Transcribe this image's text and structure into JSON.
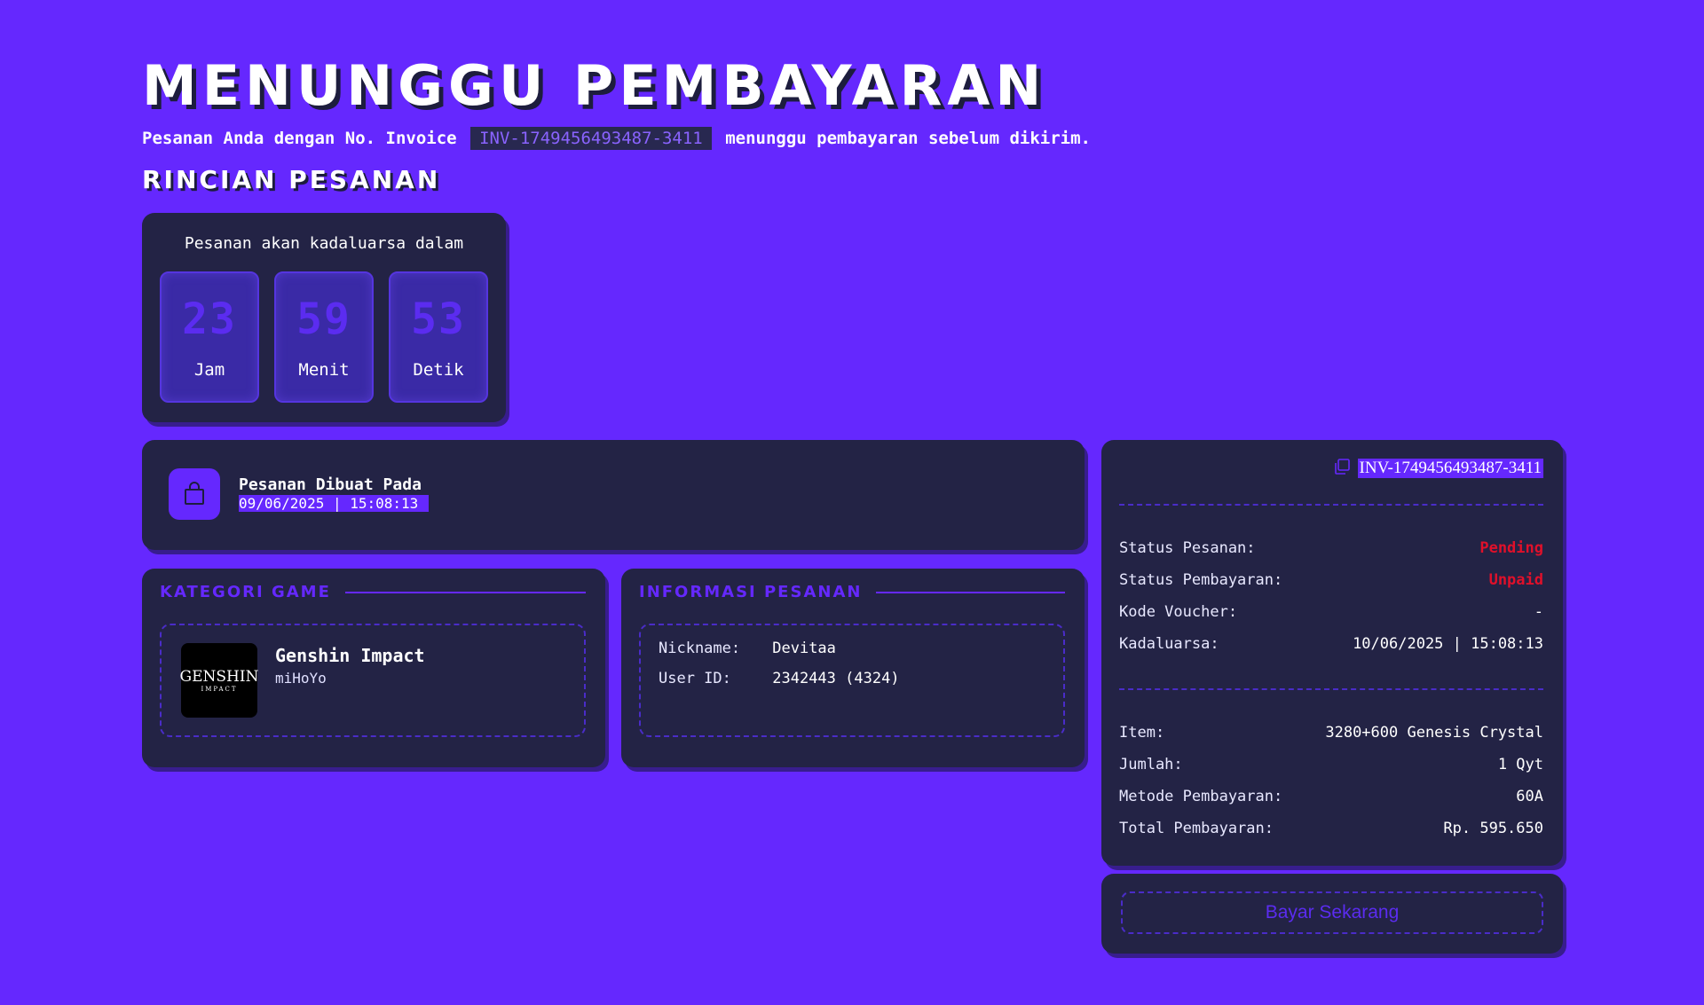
{
  "header": {
    "title": "MENUNGGU PEMBAYARAN",
    "subtitle_before": "Pesanan Anda dengan No. Invoice",
    "invoice": "INV-1749456493487-3411",
    "subtitle_after": "menunggu pembayaran sebelum dikirim.",
    "section_title": "RINCIAN PESANAN"
  },
  "countdown": {
    "label": "Pesanan akan kadaluarsa dalam",
    "hours": "23",
    "hours_label": "Jam",
    "minutes": "59",
    "minutes_label": "Menit",
    "seconds": "53",
    "seconds_label": "Detik"
  },
  "created": {
    "icon": "shopping-bag-icon",
    "label": "Pesanan Dibuat Pada",
    "value": "09/06/2025 | 15:08:13"
  },
  "game": {
    "heading": "KATEGORI GAME",
    "name": "Genshin Impact",
    "publisher": "miHoYo",
    "logo_text": "GENSHIN",
    "logo_sub": "IMPACT"
  },
  "order_info": {
    "heading": "INFORMASI PESANAN",
    "nickname_label": "Nickname:",
    "nickname": "Devitaa",
    "userid_label": "User ID:",
    "userid": "2342443 (4324)"
  },
  "summary": {
    "invoice": "INV-1749456493487-3411",
    "copy_icon": "copy-icon",
    "status_order_label": "Status Pesanan:",
    "status_order": "Pending",
    "status_payment_label": "Status Pembayaran:",
    "status_payment": "Unpaid",
    "voucher_label": "Kode Voucher:",
    "voucher": "-",
    "expiry_label": "Kadaluarsa:",
    "expiry": "10/06/2025 | 15:08:13",
    "item_label": "Item:",
    "item": "3280+600 Genesis Crystal",
    "qty_label": "Jumlah:",
    "qty": "1 Qyt",
    "method_label": "Metode Pembayaran:",
    "method": "60A",
    "total_label": "Total Pembayaran:",
    "total": "Rp. 595.650"
  },
  "pay_button": "Bayar Sekarang",
  "colors": {
    "background": "#6528FE",
    "card": "#232345",
    "accent": "#6528FE",
    "status_red": "#e0102a"
  }
}
